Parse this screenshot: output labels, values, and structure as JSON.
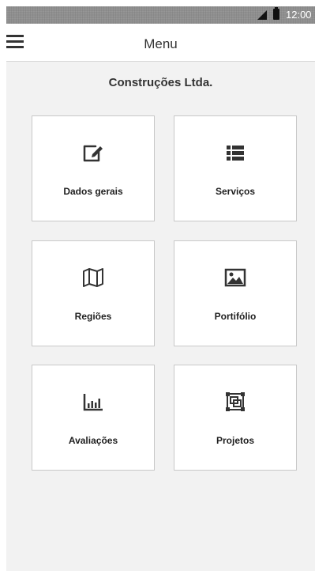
{
  "status_bar": {
    "time": "12:00",
    "signal_icon": "signal-icon",
    "battery_icon": "battery-icon"
  },
  "app_bar": {
    "title": "Menu",
    "menu_icon": "hamburger-menu-icon"
  },
  "company": {
    "name": "Construções Ltda."
  },
  "tiles": [
    {
      "label": "Dados gerais",
      "icon": "edit-icon"
    },
    {
      "label": "Serviços",
      "icon": "list-icon"
    },
    {
      "label": "Regiões",
      "icon": "map-icon"
    },
    {
      "label": "Portifólio",
      "icon": "image-icon"
    },
    {
      "label": "Avaliações",
      "icon": "bar-chart-icon"
    },
    {
      "label": "Projetos",
      "icon": "object-group-icon"
    }
  ],
  "colors": {
    "background": "#f2f2f2",
    "surface": "#ffffff",
    "text": "#333333",
    "border": "#c8c8c8",
    "status_bar": "#8f8f8f"
  }
}
